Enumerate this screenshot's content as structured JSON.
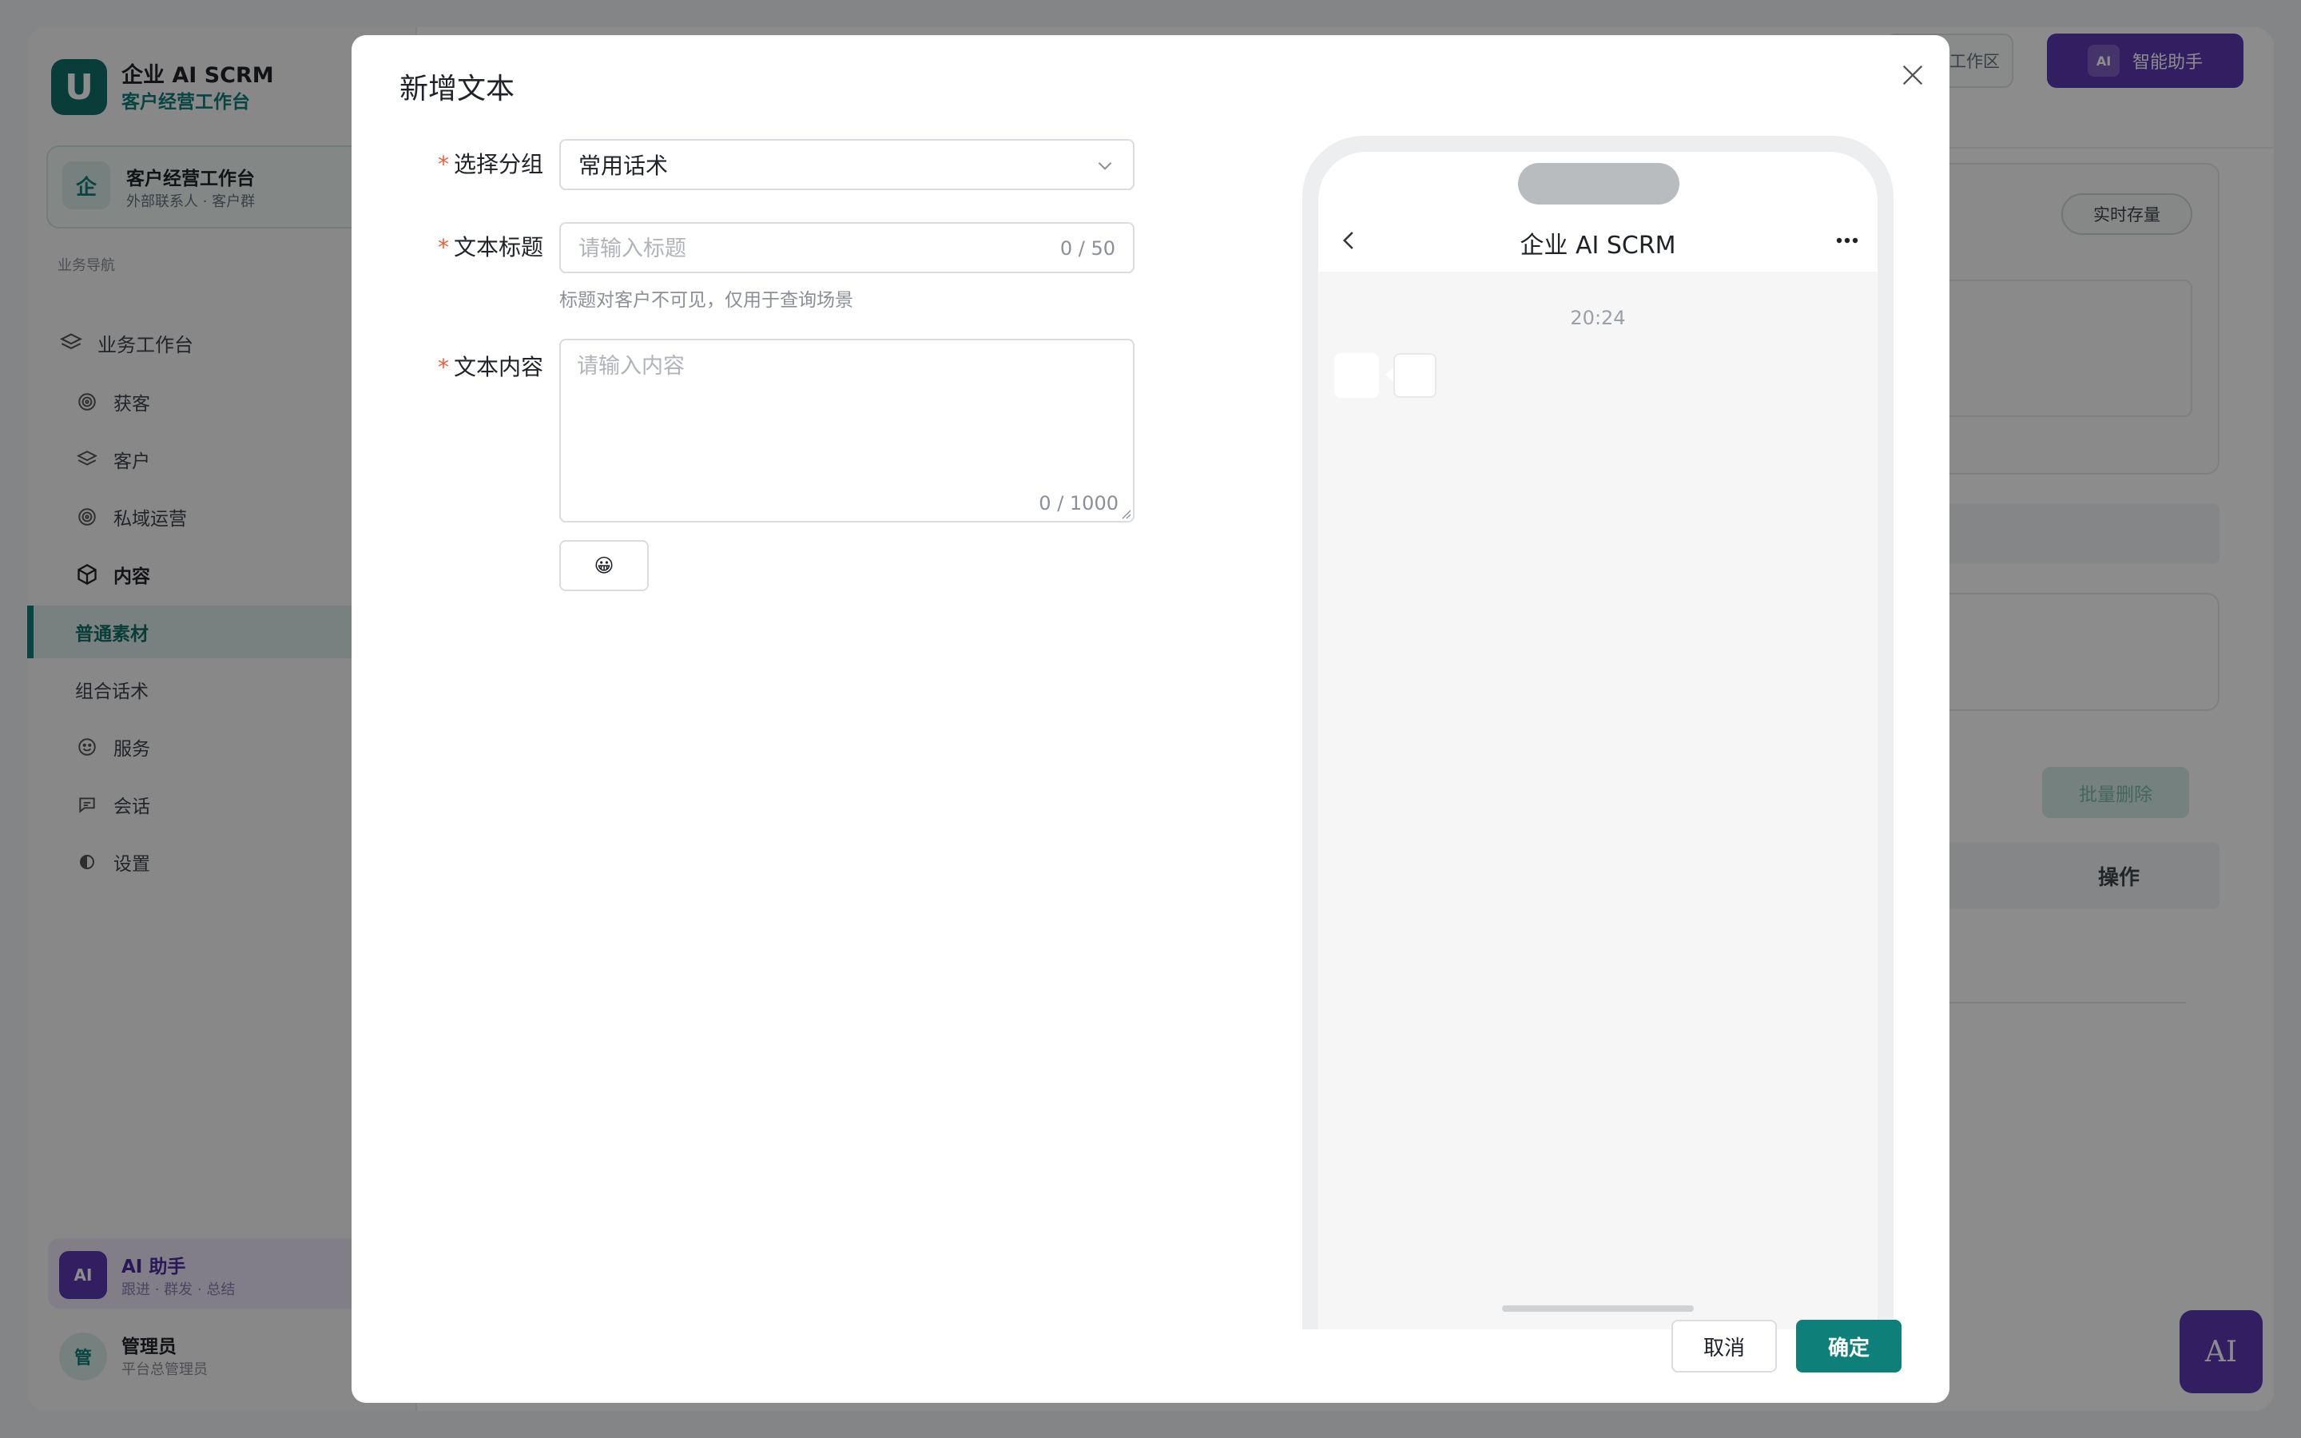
{
  "app": {
    "name": "企业 AI SCRM",
    "subtitle": "客户经营工作台",
    "logo_letter": "U",
    "workspace": {
      "icon": "企",
      "title": "客户经营工作台",
      "subtitle": "外部联系人 · 客户群"
    },
    "nav_group": "业务导航",
    "nav": [
      {
        "label": "业务工作台",
        "icon": "layers-icon"
      },
      {
        "label": "获客",
        "icon": "target-icon"
      },
      {
        "label": "客户",
        "icon": "layers-icon"
      },
      {
        "label": "私域运营",
        "icon": "target-icon"
      },
      {
        "label": "内容",
        "icon": "cube-icon"
      },
      {
        "label": "普通素材"
      },
      {
        "label": "组合话术"
      },
      {
        "label": "服务",
        "icon": "smile-icon"
      },
      {
        "label": "会话",
        "icon": "chat-icon"
      },
      {
        "label": "设置",
        "icon": "settings-icon"
      }
    ],
    "ai_assistant": {
      "badge": "AI",
      "title": "AI 助手",
      "subtitle": "跟进 · 群发 · 总结"
    },
    "admin": {
      "avatar": "管",
      "name": "管理员",
      "role": "平台总管理员"
    },
    "header": {
      "wechat_workspace": "业微信工作区",
      "ai_button": "智能助手",
      "ai_mini": "AI"
    },
    "realtime_badge": "实时存量",
    "bulk_delete": "批量删除",
    "ops_column": "操作",
    "fab": "AI"
  },
  "modal": {
    "title": "新增文本",
    "fields": {
      "group": {
        "label": "选择分组",
        "value": "常用话术"
      },
      "title": {
        "label": "文本标题",
        "placeholder": "请输入标题",
        "counter": "0 / 50",
        "hint": "标题对客户不可见，仅用于查询场景"
      },
      "content": {
        "label": "文本内容",
        "placeholder": "请输入内容",
        "counter": "0 / 1000"
      }
    },
    "emoji_button": "😀",
    "preview": {
      "contact_name": "企业 AI SCRM",
      "time": "20:24"
    },
    "buttons": {
      "cancel": "取消",
      "ok": "确定"
    }
  },
  "colors": {
    "accent": "#0f7f79",
    "ai_purple": "#5b3ab3",
    "required": "#e8603c"
  }
}
